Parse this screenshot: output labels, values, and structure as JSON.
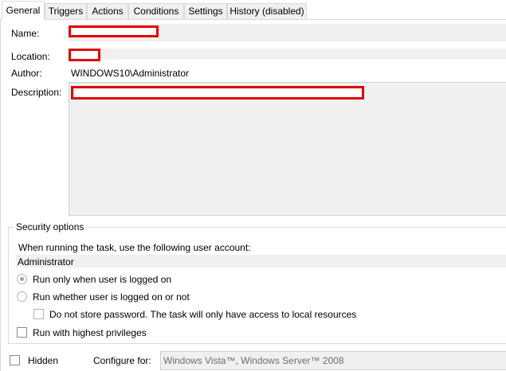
{
  "tabs": [
    {
      "label": "General",
      "active": true
    },
    {
      "label": "Triggers"
    },
    {
      "label": "Actions"
    },
    {
      "label": "Conditions"
    },
    {
      "label": "Settings"
    },
    {
      "label": "History (disabled)"
    }
  ],
  "general": {
    "name_label": "Name:",
    "location_label": "Location:",
    "author_label": "Author:",
    "author_value": "WINDOWS10\\Administrator",
    "description_label": "Description:"
  },
  "security": {
    "legend": "Security options",
    "account_prompt": "When running the task, use the following user account:",
    "account_value": "Administrator",
    "run_logged_on": "Run only when user is logged on",
    "run_whether": "Run whether user is logged on or not",
    "no_store_password": "Do not store password.  The task will only have access to local resources",
    "highest_privileges": "Run with highest privileges"
  },
  "footer": {
    "hidden_label": "Hidden",
    "configure_label": "Configure for:",
    "configure_value": "Windows Vista™, Windows Server™ 2008"
  },
  "colors": {
    "redaction": "#e20000",
    "field_bg": "#f0f0f0"
  }
}
